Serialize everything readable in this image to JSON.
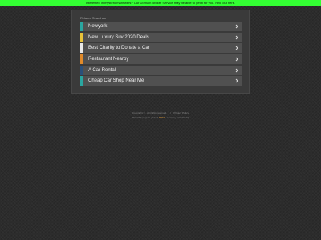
{
  "banner": {
    "text": "Interested in mysteriumanswers? Our Domain Broker Service may be able to get it for you. Find out here.",
    "background": "#33ff33"
  },
  "panel": {
    "title": "Related Searches",
    "items": [
      {
        "label": "Newyork",
        "accent": "#2aa6a0",
        "icon": "chevron-right-icon"
      },
      {
        "label": "New Luxury Suv 2020 Deals",
        "accent": "#e8c33a",
        "icon": "chevron-right-icon"
      },
      {
        "label": "Best Charity to Donate a Car",
        "accent": "#e8e8e8",
        "icon": "chevron-right-icon"
      },
      {
        "label": "Restaurant Nearby",
        "accent": "#e08a2a",
        "icon": "chevron-right-icon"
      },
      {
        "label": "A Car Rental",
        "accent": "#2a4f7a",
        "icon": "chevron-right-icon"
      },
      {
        "label": "Cheap Car Shop Near Me",
        "accent": "#2aa6a0",
        "icon": "chevron-right-icon"
      }
    ]
  },
  "footer": {
    "copyright": "Copyright © . All rights reserved.",
    "separator": "|",
    "privacy": "Privacy Policy",
    "line2_prefix": "This Web page is parked",
    "brand": "FREE",
    "line2_suffix": ", courtesy of GoDaddy",
    "brand_color": "#e9a23b"
  }
}
